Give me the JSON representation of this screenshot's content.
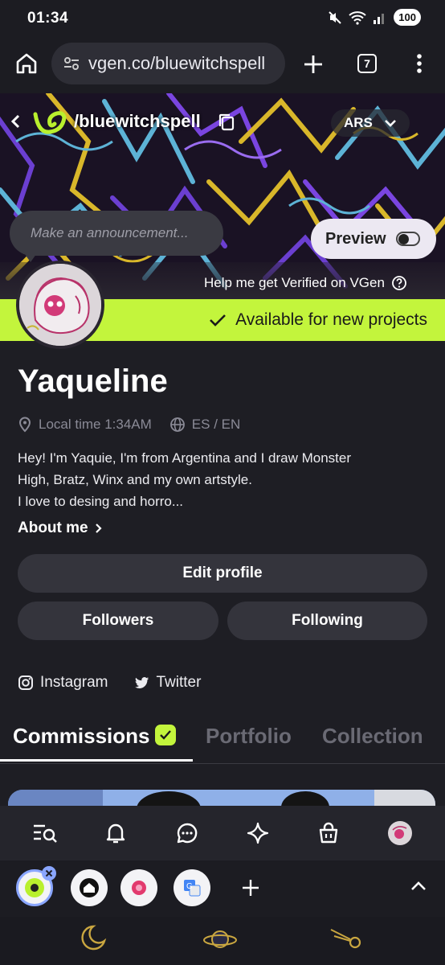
{
  "status_bar": {
    "time": "01:34",
    "battery": "100"
  },
  "browser": {
    "url": "vgen.co/bluewitchspell",
    "tab_count": "7"
  },
  "header": {
    "handle": "/bluewitchspell",
    "currency": "ARS"
  },
  "banner": {
    "announcement_placeholder": "Make an announcement...",
    "preview_label": "Preview",
    "preview_enabled": false,
    "verify_text": "Help me get Verified on VGen"
  },
  "availability": {
    "text": "Available for new projects",
    "color": "#c3f53c"
  },
  "profile": {
    "name": "Yaqueline",
    "local_time": "Local time 1:34AM",
    "languages": "ES / EN",
    "bio_lines": [
      "Hey! I'm Yaquie, I'm from Argentina and I draw Monster",
      "High, Bratz, Winx and my own artstyle.",
      "I love to desing and horro..."
    ],
    "about_label": "About me"
  },
  "actions": {
    "edit_profile": "Edit profile",
    "followers": "Followers",
    "following": "Following"
  },
  "socials": [
    {
      "label": "Instagram",
      "icon": "instagram-icon"
    },
    {
      "label": "Twitter",
      "icon": "twitter-icon"
    }
  ],
  "tabs": [
    {
      "label": "Commissions",
      "active": true
    },
    {
      "label": "Portfolio",
      "active": false
    },
    {
      "label": "Collection",
      "active": false
    }
  ],
  "app_nav": [
    "search-list-icon",
    "bell-icon",
    "chat-icon",
    "sparkle-icon",
    "shopping-bag-icon",
    "profile-avatar"
  ],
  "browser_tabs": [
    "vgen-tab",
    "home-tab",
    "flower-tab",
    "translate-tab"
  ]
}
